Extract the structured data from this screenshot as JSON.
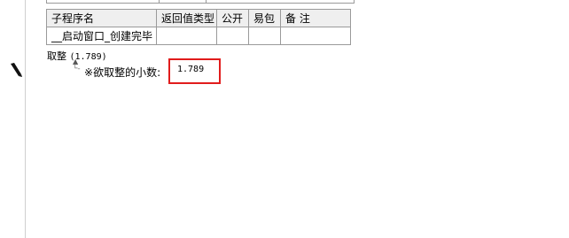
{
  "table": {
    "headers": [
      "子程序名",
      "返回值类型",
      "公开",
      "易包",
      "备 注"
    ],
    "row": {
      "name": "__启动窗口_创建完毕",
      "return_type": "",
      "public": "",
      "easy_pkg": "",
      "note": ""
    }
  },
  "code": {
    "command": "取整",
    "args": "(1.789)"
  },
  "param": {
    "prefix_mark": "※",
    "label": "欲取整的小数:",
    "value": "1.789"
  },
  "icons": {
    "cursor": "pencil-cursor-icon",
    "tree": "tree-branch-icon"
  },
  "colors": {
    "highlight_border": "#e11c1c",
    "grid": "#9a9a9a",
    "header_bg": "#efefef"
  }
}
